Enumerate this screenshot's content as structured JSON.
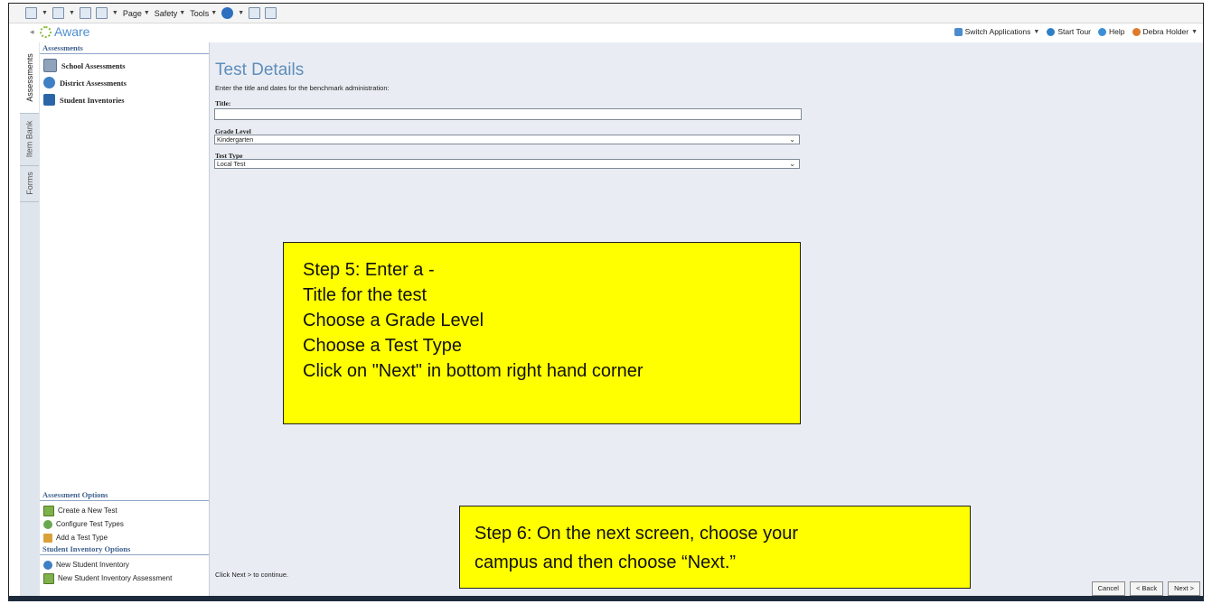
{
  "ie_toolbar": {
    "page_label": "Page",
    "safety_label": "Safety",
    "tools_label": "Tools"
  },
  "app": {
    "logo_text": "Aware",
    "top_links": {
      "switch_apps": "Switch Applications",
      "start_tour": "Start Tour",
      "help": "Help",
      "user": "Debra Holder"
    }
  },
  "vertical_tabs": [
    "Assessments",
    "Item Bank",
    "Forms"
  ],
  "sidebar": {
    "assessments_header": "Assessments",
    "items": [
      {
        "label": "School Assessments",
        "icon": "grid-icon"
      },
      {
        "label": "District Assessments",
        "icon": "globe-icon"
      },
      {
        "label": "Student Inventories",
        "icon": "book-icon"
      }
    ],
    "assessment_options_header": "Assessment Options",
    "assessment_options": [
      "Create a New Test",
      "Configure Test Types",
      "Add a Test Type"
    ],
    "student_inventory_header": "Student Inventory Options",
    "student_inventory_options": [
      "New Student Inventory",
      "New Student Inventory Assessment"
    ]
  },
  "form": {
    "title": "Test Details",
    "instructions": "Enter the title and dates for the benchmark administration:",
    "title_label": "Title:",
    "title_value": "",
    "grade_label": "Grade Level",
    "grade_value": "Kindergarten",
    "test_type_label": "Test Type",
    "test_type_value": "Local Test"
  },
  "footer": {
    "hint": "Click Next > to continue.",
    "cancel": "Cancel",
    "back": "< Back",
    "next": "Next >"
  },
  "callouts": {
    "step5": [
      "Step 5:  Enter a -",
      "Title for the test",
      "Choose a Grade Level",
      "Choose a Test Type",
      "Click on \"Next\" in bottom right hand corner"
    ],
    "step6": [
      "Step 6: On the next screen, choose your",
      "campus and then choose “Next.”"
    ]
  }
}
